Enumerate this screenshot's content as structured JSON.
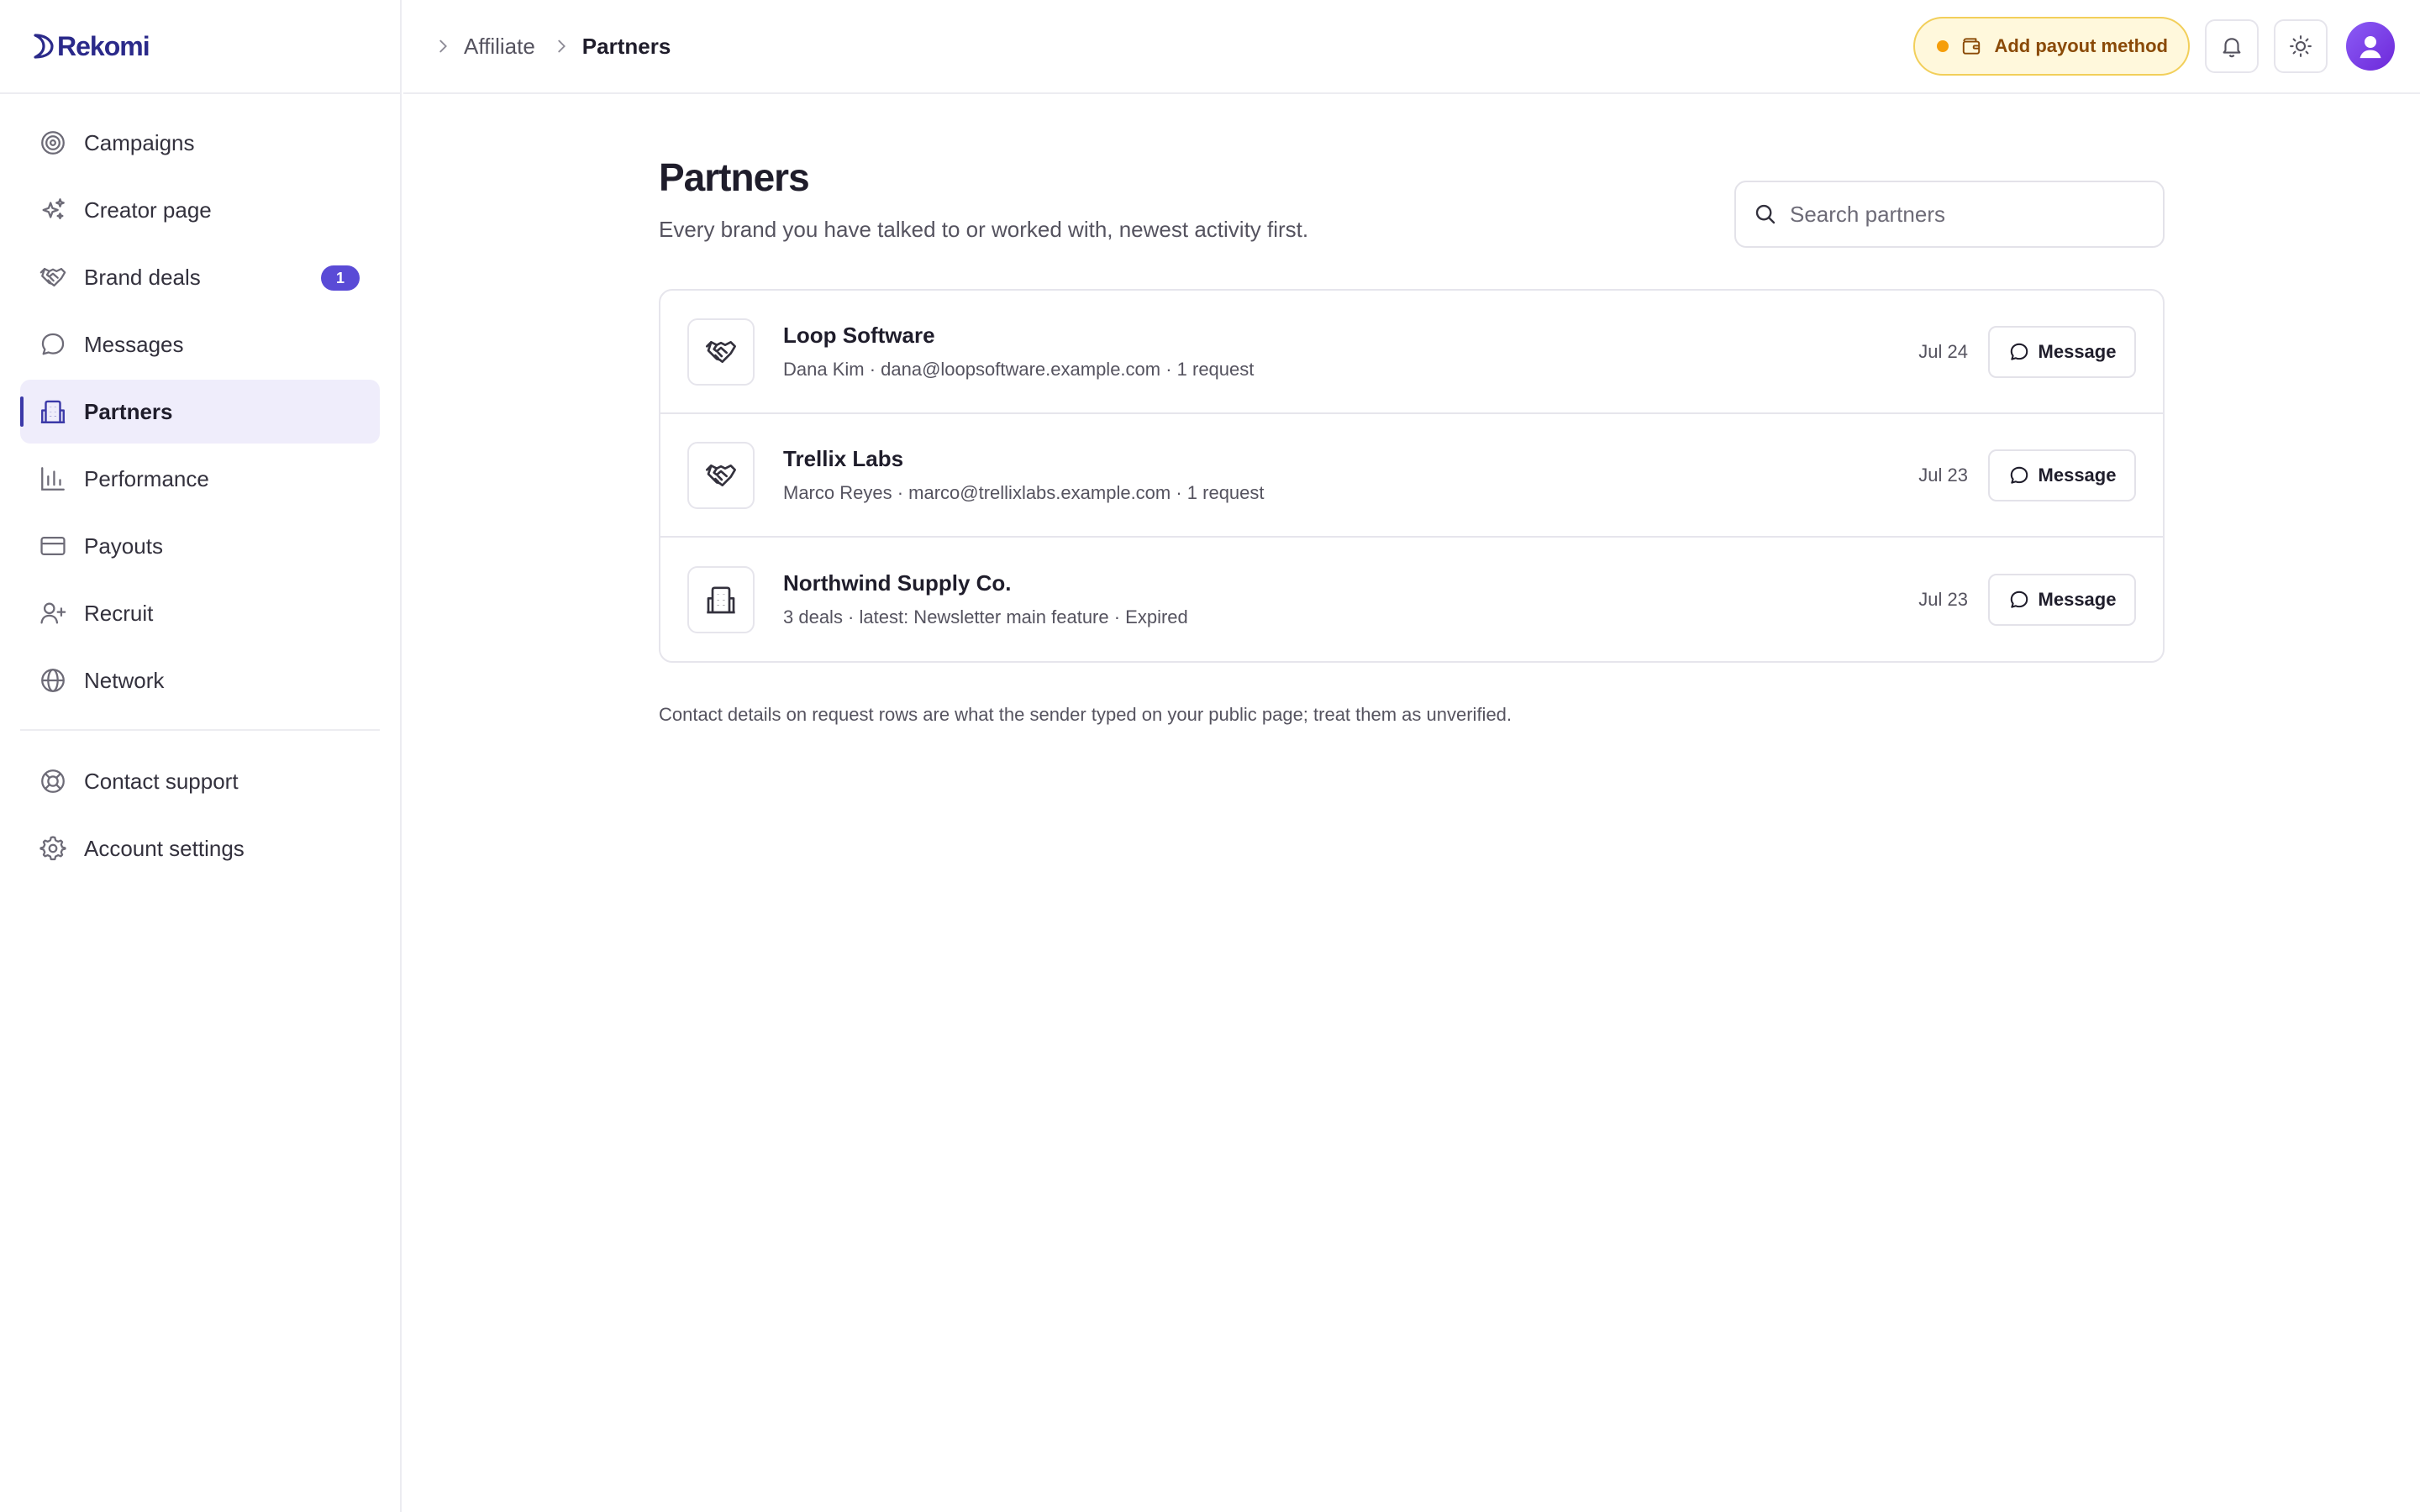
{
  "app": {
    "logo_text": "Rekomi"
  },
  "sidebar": {
    "items": [
      {
        "label": "Campaigns",
        "icon": "target-icon"
      },
      {
        "label": "Creator page",
        "icon": "sparkles-icon"
      },
      {
        "label": "Brand deals",
        "icon": "handshake-icon",
        "badge": "1"
      },
      {
        "label": "Messages",
        "icon": "chat-bubble-icon"
      },
      {
        "label": "Partners",
        "icon": "building-icon",
        "active": true
      },
      {
        "label": "Performance",
        "icon": "bar-chart-icon"
      },
      {
        "label": "Payouts",
        "icon": "credit-card-icon"
      },
      {
        "label": "Recruit",
        "icon": "user-plus-icon"
      },
      {
        "label": "Network",
        "icon": "globe-icon"
      }
    ],
    "footer_items": [
      {
        "label": "Contact support",
        "icon": "life-buoy-icon"
      },
      {
        "label": "Account settings",
        "icon": "gear-icon"
      }
    ]
  },
  "header": {
    "breadcrumb": [
      "Affiliate",
      "Partners"
    ],
    "payout_button": "Add payout method"
  },
  "main": {
    "title": "Partners",
    "subtitle": "Every brand you have talked to or worked with, newest activity first.",
    "search_placeholder": "Search partners",
    "partners": [
      {
        "name": "Loop Software",
        "meta": "Dana Kim · dana@loopsoftware.example.com · 1 request",
        "date": "Jul 24",
        "action": "Message",
        "icon": "handshake-icon"
      },
      {
        "name": "Trellix Labs",
        "meta": "Marco Reyes · marco@trellixlabs.example.com · 1 request",
        "date": "Jul 23",
        "action": "Message",
        "icon": "handshake-icon"
      },
      {
        "name": "Northwind Supply Co.",
        "meta": "3 deals · latest: Newsletter main feature · Expired",
        "date": "Jul 23",
        "action": "Message",
        "icon": "building-icon"
      }
    ],
    "footnote": "Contact details on request rows are what the sender typed on your public page; treat them as unverified."
  },
  "colors": {
    "accent": "#3b39a8",
    "badge": "#5a4bd6",
    "active_bg": "#efedfb",
    "payout_bg": "#fff8dc",
    "payout_border": "#f2cf5a",
    "payout_text": "#8a4a07",
    "payout_dot": "#f59e0b",
    "avatar": "#7c3aed"
  }
}
